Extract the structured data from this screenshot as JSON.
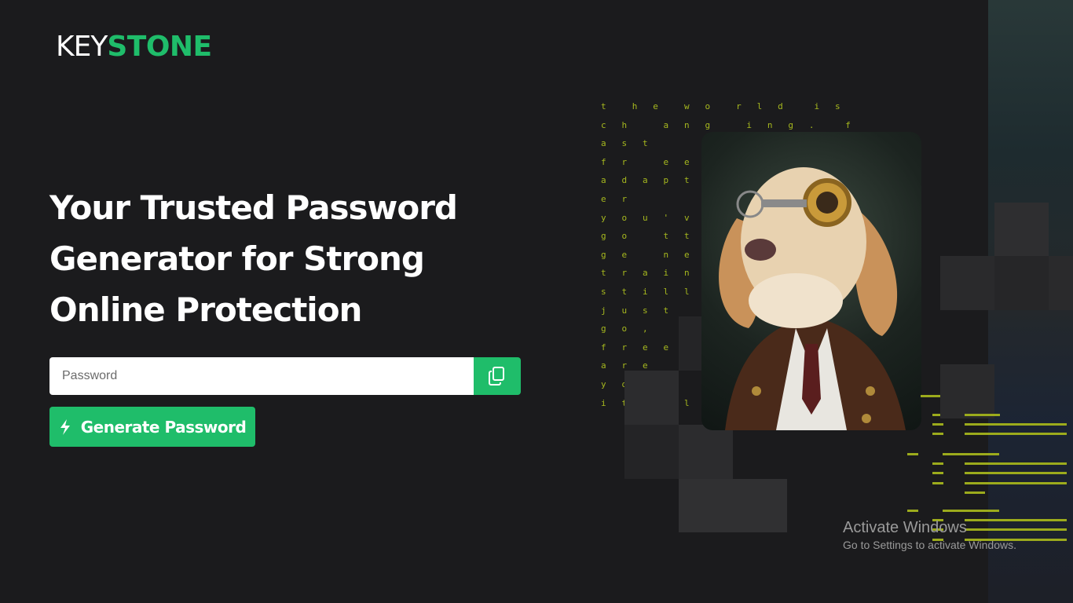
{
  "brand": {
    "part1": "KEY",
    "part2": "STONE"
  },
  "hero": {
    "line1": "Your Trusted Password",
    "line2": "Generator for Strong",
    "line3": "Online Protection"
  },
  "password": {
    "placeholder": "Password",
    "value": ""
  },
  "generate_button": {
    "label": "Generate Password",
    "icon": "bolt-icon"
  },
  "copy_button": {
    "icon": "copy-icon"
  },
  "matrix_text": [
    "t     h   e     w   o     r   l   d      i   s",
    "c   h       a   n   g       i   n   g   .      f",
    "a   s   t",
    "f   r       e   e",
    "a   d   a   p   t",
    "e   r",
    "y   o   u   '   v",
    "g   o       t   t",
    "g   e       n   e",
    "t   r   a   i   n",
    "s   t   i   l   l",
    "j   u   s   t",
    "g   o   ,",
    "f   r   e   e",
    "a   r   e",
    "y   o       n",
    "i   t       l   l"
  ],
  "watermark": {
    "title": "Activate Windows",
    "subtitle": "Go to Settings to activate Windows."
  },
  "colors": {
    "accent": "#1fbd6a",
    "background": "#1b1b1d",
    "matrix": "#a6b81e"
  }
}
